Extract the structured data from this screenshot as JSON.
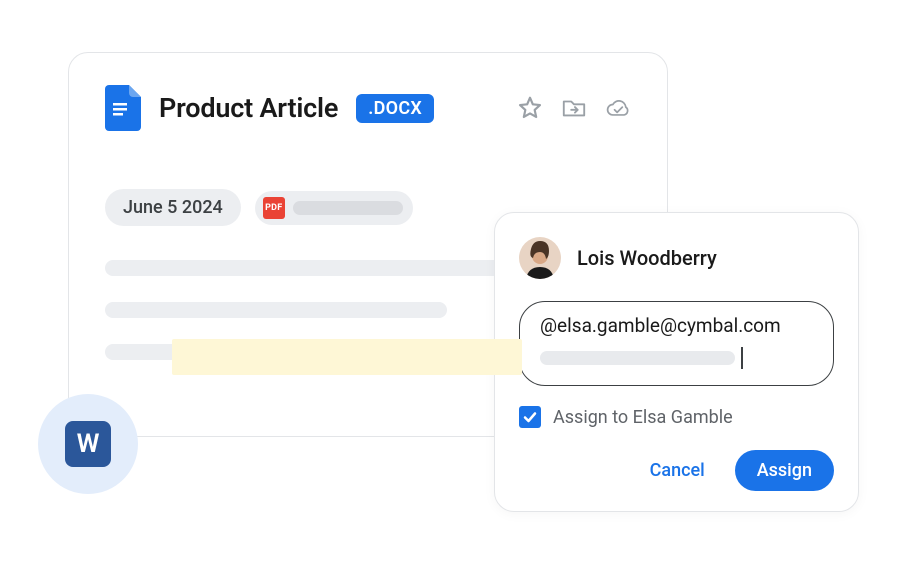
{
  "doc": {
    "title": "Product Article",
    "badge": ".DOCX",
    "date": "June 5 2024",
    "pdf_label": "PDF"
  },
  "word_app": {
    "letter": "W"
  },
  "popup": {
    "author": "Lois Woodberry",
    "mention": "@elsa.gamble@cymbal.com",
    "assign_label": "Assign to Elsa Gamble",
    "cancel": "Cancel",
    "assign": "Assign"
  },
  "colors": {
    "primary": "#1a73e8"
  }
}
